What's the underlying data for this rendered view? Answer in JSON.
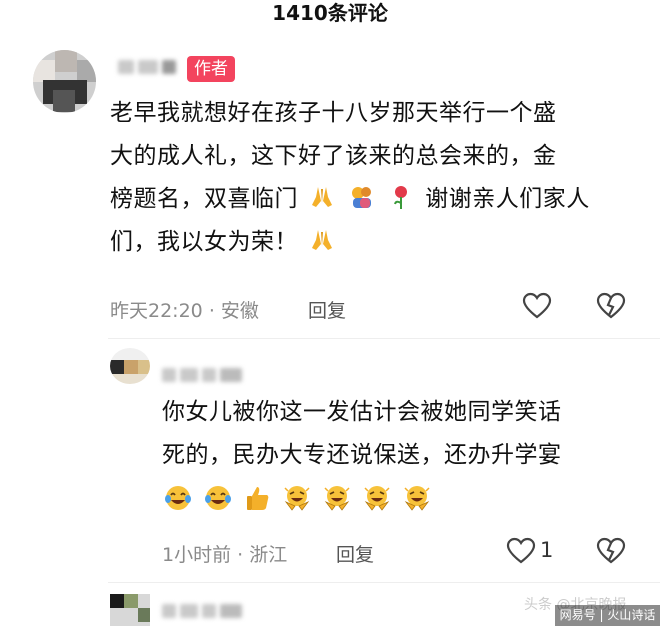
{
  "header": {
    "title": "1410条评论"
  },
  "comments": [
    {
      "author_badge": "作者",
      "text_lines": [
        "老早我就想好在孩子十八岁那天举行一个盛",
        "大的成人礼，这下好了该来的总会来的，金",
        "榜题名，双喜临门",
        "们，我以女为荣！"
      ],
      "line3_after_emojis": "谢谢亲人们家人",
      "emojis_line3": [
        "folded-hands",
        "hug",
        "rose"
      ],
      "emojis_line4": [
        "folded-hands"
      ],
      "time": "昨天22:20",
      "location": "安徽",
      "reply_label": "回复",
      "like_count": ""
    },
    {
      "text_lines": [
        "你女儿被你这一发估计会被她同学笑话",
        "死的，民办大专还说保送，还办升学宴"
      ],
      "emojis": [
        "crying-laughing",
        "crying-laughing",
        "thumbs-up",
        "laughing-clapping",
        "laughing-clapping",
        "laughing-clapping",
        "laughing-clapping"
      ],
      "time": "1小时前",
      "location": "浙江",
      "reply_label": "回复",
      "like_count": "1"
    }
  ],
  "watermark": {
    "line1": "头条 @北京晚报",
    "line2": "网易号 | 火山诗话"
  },
  "colors": {
    "badge": "#f3445e",
    "meta": "#8a8a8a"
  }
}
